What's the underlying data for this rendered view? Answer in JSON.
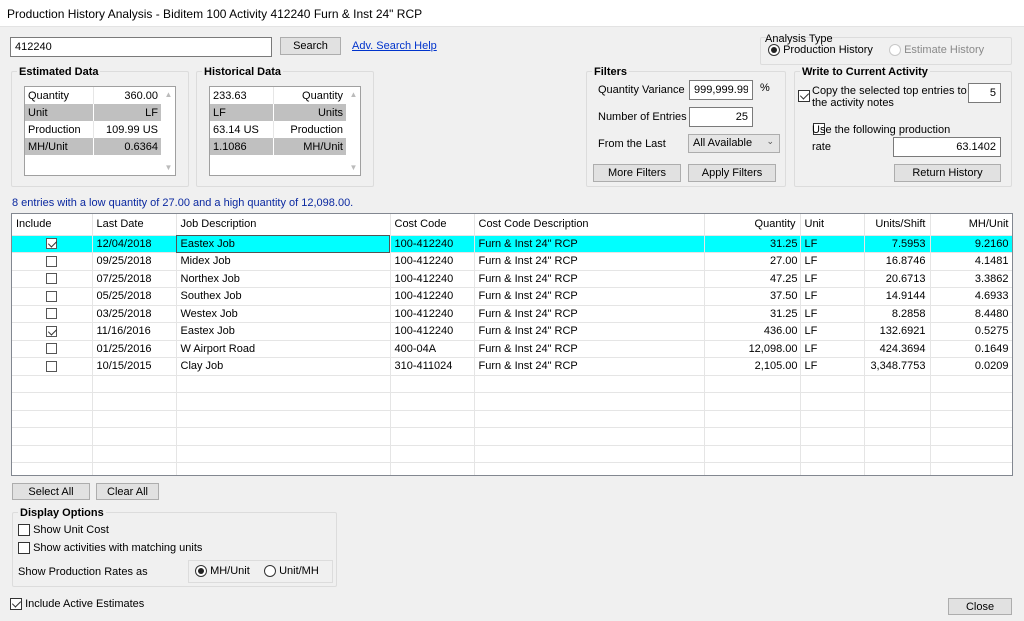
{
  "window": {
    "title": "Production History Analysis - Biditem 100 Activity 412240 Furn & Inst 24\" RCP"
  },
  "search": {
    "value": "412240",
    "button_label": "Search",
    "help_link": "Adv. Search Help"
  },
  "analysis_type": {
    "title": "Analysis Type",
    "options": [
      {
        "label": "Production History",
        "selected": true,
        "enabled": true
      },
      {
        "label": "Estimate History",
        "selected": false,
        "enabled": false
      }
    ]
  },
  "estimated_data": {
    "title": "Estimated Data",
    "rows": [
      {
        "label": "Quantity",
        "value": "360.00"
      },
      {
        "label": "Unit",
        "value": "LF"
      },
      {
        "label": "Production",
        "value": "109.99 US"
      },
      {
        "label": "MH/Unit",
        "value": "0.6364"
      }
    ]
  },
  "historical_data": {
    "title": "Historical Data",
    "rows": [
      {
        "value": "233.63",
        "label": "Quantity"
      },
      {
        "value": "LF",
        "label": "Units"
      },
      {
        "value": "63.14 US",
        "label": "Production"
      },
      {
        "value": "1.1086",
        "label": "MH/Unit"
      }
    ]
  },
  "filters": {
    "title": "Filters",
    "quantity_variance_label": "Quantity Variance",
    "quantity_variance_value": "999,999.99",
    "quantity_variance_unit": "%",
    "number_of_entries_label": "Number of Entries",
    "number_of_entries_value": "25",
    "from_the_last_label": "From the Last",
    "from_the_last_value": "All Available",
    "more_filters_label": "More Filters",
    "apply_filters_label": "Apply Filters"
  },
  "write_activity": {
    "title": "Write to Current Activity",
    "copy_entries_label": "Copy the selected top entries to the activity notes",
    "copy_entries_line1": "Copy the selected top entries to",
    "copy_entries_line2": "the activity notes",
    "copy_entries_checked": true,
    "copy_entries_count": "5",
    "use_production_line1": "Use the following production",
    "use_production_line2": "rate",
    "use_production_checked": false,
    "rate_value": "63.1402",
    "return_history_label": "Return History"
  },
  "summary": "8 entries with a low quantity of 27.00 and a high quantity of 12,098.00.",
  "table": {
    "columns": [
      "Include",
      "Last Date",
      "Job Description",
      "Cost Code",
      "Cost Code Description",
      "Quantity",
      "Unit",
      "Units/Shift",
      "MH/Unit"
    ],
    "rows": [
      {
        "include": true,
        "date": "12/04/2018",
        "job": "Eastex Job",
        "code": "100-412240",
        "desc": "Furn & Inst 24\" RCP",
        "qty": "31.25",
        "unit": "LF",
        "ups": "7.5953",
        "mhu": "9.2160",
        "selected": true
      },
      {
        "include": false,
        "date": "09/25/2018",
        "job": "Midex Job",
        "code": "100-412240",
        "desc": "Furn & Inst 24\" RCP",
        "qty": "27.00",
        "unit": "LF",
        "ups": "16.8746",
        "mhu": "4.1481"
      },
      {
        "include": false,
        "date": "07/25/2018",
        "job": "Northex Job",
        "code": "100-412240",
        "desc": "Furn & Inst 24\" RCP",
        "qty": "47.25",
        "unit": "LF",
        "ups": "20.6713",
        "mhu": "3.3862"
      },
      {
        "include": false,
        "date": "05/25/2018",
        "job": "Southex Job",
        "code": "100-412240",
        "desc": "Furn & Inst 24\" RCP",
        "qty": "37.50",
        "unit": "LF",
        "ups": "14.9144",
        "mhu": "4.6933"
      },
      {
        "include": false,
        "date": "03/25/2018",
        "job": "Westex Job",
        "code": "100-412240",
        "desc": "Furn & Inst 24\" RCP",
        "qty": "31.25",
        "unit": "LF",
        "ups": "8.2858",
        "mhu": "8.4480"
      },
      {
        "include": true,
        "date": "11/16/2016",
        "job": "Eastex Job",
        "code": "100-412240",
        "desc": "Furn & Inst 24\" RCP",
        "qty": "436.00",
        "unit": "LF",
        "ups": "132.6921",
        "mhu": "0.5275"
      },
      {
        "include": false,
        "date": "01/25/2016",
        "job": "W Airport Road",
        "code": "400-04A",
        "desc": "Furn & Inst 24\" RCP",
        "qty": "12,098.00",
        "unit": "LF",
        "ups": "424.3694",
        "mhu": "0.1649"
      },
      {
        "include": false,
        "date": "10/15/2015",
        "job": "Clay Job",
        "code": "310-411024",
        "desc": "Furn & Inst 24\" RCP",
        "qty": "2,105.00",
        "unit": "LF",
        "ups": "3,348.7753",
        "mhu": "0.0209"
      }
    ]
  },
  "bottom": {
    "select_all_label": "Select All",
    "clear_all_label": "Clear All",
    "display_options_title": "Display Options",
    "show_unit_cost_label": "Show Unit Cost",
    "show_unit_cost_checked": false,
    "show_matching_units_label": "Show activities with matching units",
    "show_matching_units_checked": false,
    "show_rates_as_label": "Show Production Rates as",
    "rate_options": [
      {
        "label": "MH/Unit",
        "selected": true
      },
      {
        "label": "Unit/MH",
        "selected": false
      }
    ],
    "include_active_label": "Include Active Estimates",
    "include_active_checked": true,
    "close_label": "Close"
  }
}
